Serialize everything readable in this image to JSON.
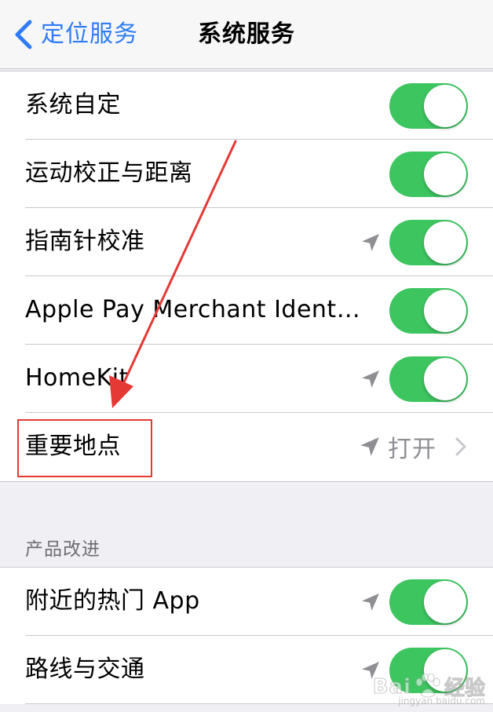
{
  "nav": {
    "back_label": "定位服务",
    "title": "系统服务"
  },
  "colors": {
    "accent": "#2f7cf6",
    "toggle_on": "#3dc560",
    "annotation": "#e53935",
    "location_icon": "#8e8e93"
  },
  "system_items": [
    {
      "label": "系统自定",
      "location_icon": false,
      "toggle": "on"
    },
    {
      "label": "运动校正与距离",
      "location_icon": false,
      "toggle": "on"
    },
    {
      "label": "指南针校准",
      "location_icon": true,
      "toggle": "on"
    },
    {
      "label": "Apple Pay Merchant Ident…",
      "location_icon": false,
      "toggle": "on"
    },
    {
      "label": "HomeKit",
      "location_icon": true,
      "toggle": "on"
    }
  ],
  "significant_locations": {
    "label": "重要地点",
    "value": "打开",
    "location_icon": true
  },
  "improvement_section": {
    "header": "产品改进",
    "items": [
      {
        "label": "附近的热门 App",
        "location_icon": true,
        "toggle": "on"
      },
      {
        "label": "路线与交通",
        "location_icon": true,
        "toggle": "on"
      }
    ]
  },
  "watermark": {
    "text": "Bai",
    "sub": "经验",
    "url": "jingyan.baidu.com",
    "icon": "baidu-paw-icon"
  }
}
